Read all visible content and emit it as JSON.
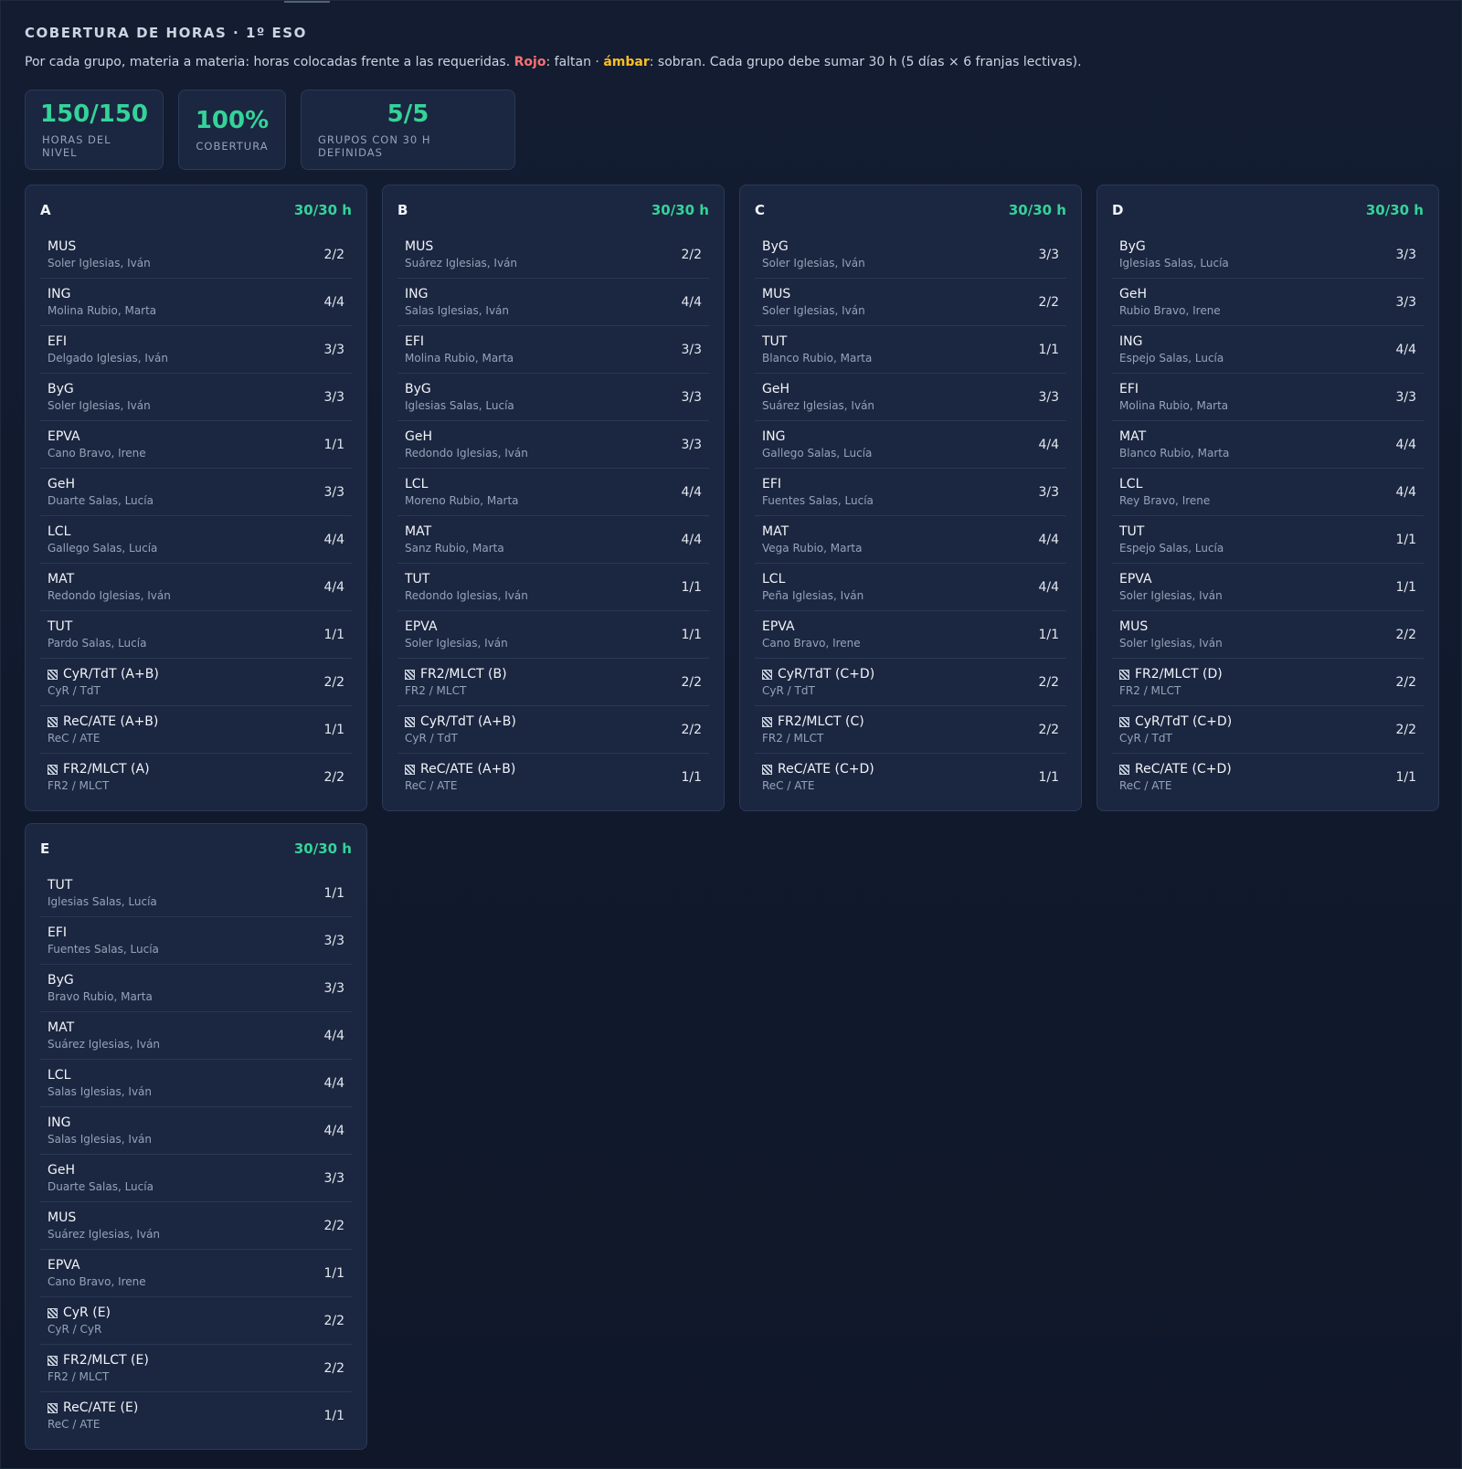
{
  "header": {
    "title": "COBERTURA DE HORAS · 1º ESO",
    "desc_pre": "Por cada grupo, materia a materia: horas colocadas frente a las requeridas. ",
    "desc_red": "Rojo",
    "desc_mid": ": faltan · ",
    "desc_amber": "ámbar",
    "desc_post": ": sobran. Cada grupo debe sumar 30 h (5 días × 6 franjas lectivas)."
  },
  "stats": [
    {
      "value": "150/150",
      "label": "HORAS DEL NIVEL"
    },
    {
      "value": "100%",
      "label": "COBERTURA"
    },
    {
      "value": "5/5",
      "label": "GRUPOS CON 30 H DEFINIDAS"
    }
  ],
  "colors": {
    "ok": "#34d399",
    "missing": "#f87171",
    "extra": "#fbbf24"
  },
  "groups": [
    {
      "name": "A",
      "total": "30/30 h",
      "rows": [
        {
          "subject": "MUS",
          "teacher": "Soler Iglesias, Iván",
          "hours": "2/2",
          "shared": false
        },
        {
          "subject": "ING",
          "teacher": "Molina Rubio, Marta",
          "hours": "4/4",
          "shared": false
        },
        {
          "subject": "EFI",
          "teacher": "Delgado Iglesias, Iván",
          "hours": "3/3",
          "shared": false
        },
        {
          "subject": "ByG",
          "teacher": "Soler Iglesias, Iván",
          "hours": "3/3",
          "shared": false
        },
        {
          "subject": "EPVA",
          "teacher": "Cano Bravo, Irene",
          "hours": "1/1",
          "shared": false
        },
        {
          "subject": "GeH",
          "teacher": "Duarte Salas, Lucía",
          "hours": "3/3",
          "shared": false
        },
        {
          "subject": "LCL",
          "teacher": "Gallego Salas, Lucía",
          "hours": "4/4",
          "shared": false
        },
        {
          "subject": "MAT",
          "teacher": "Redondo Iglesias, Iván",
          "hours": "4/4",
          "shared": false
        },
        {
          "subject": "TUT",
          "teacher": "Pardo Salas, Lucía",
          "hours": "1/1",
          "shared": false
        },
        {
          "subject": "CyR/TdT (A+B)",
          "teacher": "CyR / TdT",
          "hours": "2/2",
          "shared": true
        },
        {
          "subject": "ReC/ATE (A+B)",
          "teacher": "ReC / ATE",
          "hours": "1/1",
          "shared": true
        },
        {
          "subject": "FR2/MLCT (A)",
          "teacher": "FR2 / MLCT",
          "hours": "2/2",
          "shared": true
        }
      ]
    },
    {
      "name": "B",
      "total": "30/30 h",
      "rows": [
        {
          "subject": "MUS",
          "teacher": "Suárez Iglesias, Iván",
          "hours": "2/2",
          "shared": false
        },
        {
          "subject": "ING",
          "teacher": "Salas Iglesias, Iván",
          "hours": "4/4",
          "shared": false
        },
        {
          "subject": "EFI",
          "teacher": "Molina Rubio, Marta",
          "hours": "3/3",
          "shared": false
        },
        {
          "subject": "ByG",
          "teacher": "Iglesias Salas, Lucía",
          "hours": "3/3",
          "shared": false
        },
        {
          "subject": "GeH",
          "teacher": "Redondo Iglesias, Iván",
          "hours": "3/3",
          "shared": false
        },
        {
          "subject": "LCL",
          "teacher": "Moreno Rubio, Marta",
          "hours": "4/4",
          "shared": false
        },
        {
          "subject": "MAT",
          "teacher": "Sanz Rubio, Marta",
          "hours": "4/4",
          "shared": false
        },
        {
          "subject": "TUT",
          "teacher": "Redondo Iglesias, Iván",
          "hours": "1/1",
          "shared": false
        },
        {
          "subject": "EPVA",
          "teacher": "Soler Iglesias, Iván",
          "hours": "1/1",
          "shared": false
        },
        {
          "subject": "FR2/MLCT (B)",
          "teacher": "FR2 / MLCT",
          "hours": "2/2",
          "shared": true
        },
        {
          "subject": "CyR/TdT (A+B)",
          "teacher": "CyR / TdT",
          "hours": "2/2",
          "shared": true
        },
        {
          "subject": "ReC/ATE (A+B)",
          "teacher": "ReC / ATE",
          "hours": "1/1",
          "shared": true
        }
      ]
    },
    {
      "name": "C",
      "total": "30/30 h",
      "rows": [
        {
          "subject": "ByG",
          "teacher": "Soler Iglesias, Iván",
          "hours": "3/3",
          "shared": false
        },
        {
          "subject": "MUS",
          "teacher": "Soler Iglesias, Iván",
          "hours": "2/2",
          "shared": false
        },
        {
          "subject": "TUT",
          "teacher": "Blanco Rubio, Marta",
          "hours": "1/1",
          "shared": false
        },
        {
          "subject": "GeH",
          "teacher": "Suárez Iglesias, Iván",
          "hours": "3/3",
          "shared": false
        },
        {
          "subject": "ING",
          "teacher": "Gallego Salas, Lucía",
          "hours": "4/4",
          "shared": false
        },
        {
          "subject": "EFI",
          "teacher": "Fuentes Salas, Lucía",
          "hours": "3/3",
          "shared": false
        },
        {
          "subject": "MAT",
          "teacher": "Vega Rubio, Marta",
          "hours": "4/4",
          "shared": false
        },
        {
          "subject": "LCL",
          "teacher": "Peña Iglesias, Iván",
          "hours": "4/4",
          "shared": false
        },
        {
          "subject": "EPVA",
          "teacher": "Cano Bravo, Irene",
          "hours": "1/1",
          "shared": false
        },
        {
          "subject": "CyR/TdT (C+D)",
          "teacher": "CyR / TdT",
          "hours": "2/2",
          "shared": true
        },
        {
          "subject": "FR2/MLCT (C)",
          "teacher": "FR2 / MLCT",
          "hours": "2/2",
          "shared": true
        },
        {
          "subject": "ReC/ATE (C+D)",
          "teacher": "ReC / ATE",
          "hours": "1/1",
          "shared": true
        }
      ]
    },
    {
      "name": "D",
      "total": "30/30 h",
      "rows": [
        {
          "subject": "ByG",
          "teacher": "Iglesias Salas, Lucía",
          "hours": "3/3",
          "shared": false
        },
        {
          "subject": "GeH",
          "teacher": "Rubio Bravo, Irene",
          "hours": "3/3",
          "shared": false
        },
        {
          "subject": "ING",
          "teacher": "Espejo Salas, Lucía",
          "hours": "4/4",
          "shared": false
        },
        {
          "subject": "EFI",
          "teacher": "Molina Rubio, Marta",
          "hours": "3/3",
          "shared": false
        },
        {
          "subject": "MAT",
          "teacher": "Blanco Rubio, Marta",
          "hours": "4/4",
          "shared": false
        },
        {
          "subject": "LCL",
          "teacher": "Rey Bravo, Irene",
          "hours": "4/4",
          "shared": false
        },
        {
          "subject": "TUT",
          "teacher": "Espejo Salas, Lucía",
          "hours": "1/1",
          "shared": false
        },
        {
          "subject": "EPVA",
          "teacher": "Soler Iglesias, Iván",
          "hours": "1/1",
          "shared": false
        },
        {
          "subject": "MUS",
          "teacher": "Soler Iglesias, Iván",
          "hours": "2/2",
          "shared": false
        },
        {
          "subject": "FR2/MLCT (D)",
          "teacher": "FR2 / MLCT",
          "hours": "2/2",
          "shared": true
        },
        {
          "subject": "CyR/TdT (C+D)",
          "teacher": "CyR / TdT",
          "hours": "2/2",
          "shared": true
        },
        {
          "subject": "ReC/ATE (C+D)",
          "teacher": "ReC / ATE",
          "hours": "1/1",
          "shared": true
        }
      ]
    },
    {
      "name": "E",
      "total": "30/30 h",
      "rows": [
        {
          "subject": "TUT",
          "teacher": "Iglesias Salas, Lucía",
          "hours": "1/1",
          "shared": false
        },
        {
          "subject": "EFI",
          "teacher": "Fuentes Salas, Lucía",
          "hours": "3/3",
          "shared": false
        },
        {
          "subject": "ByG",
          "teacher": "Bravo Rubio, Marta",
          "hours": "3/3",
          "shared": false
        },
        {
          "subject": "MAT",
          "teacher": "Suárez Iglesias, Iván",
          "hours": "4/4",
          "shared": false
        },
        {
          "subject": "LCL",
          "teacher": "Salas Iglesias, Iván",
          "hours": "4/4",
          "shared": false
        },
        {
          "subject": "ING",
          "teacher": "Salas Iglesias, Iván",
          "hours": "4/4",
          "shared": false
        },
        {
          "subject": "GeH",
          "teacher": "Duarte Salas, Lucía",
          "hours": "3/3",
          "shared": false
        },
        {
          "subject": "MUS",
          "teacher": "Suárez Iglesias, Iván",
          "hours": "2/2",
          "shared": false
        },
        {
          "subject": "EPVA",
          "teacher": "Cano Bravo, Irene",
          "hours": "1/1",
          "shared": false
        },
        {
          "subject": "CyR (E)",
          "teacher": "CyR / CyR",
          "hours": "2/2",
          "shared": true
        },
        {
          "subject": "FR2/MLCT (E)",
          "teacher": "FR2 / MLCT",
          "hours": "2/2",
          "shared": true
        },
        {
          "subject": "ReC/ATE (E)",
          "teacher": "ReC / ATE",
          "hours": "1/1",
          "shared": true
        }
      ]
    }
  ]
}
